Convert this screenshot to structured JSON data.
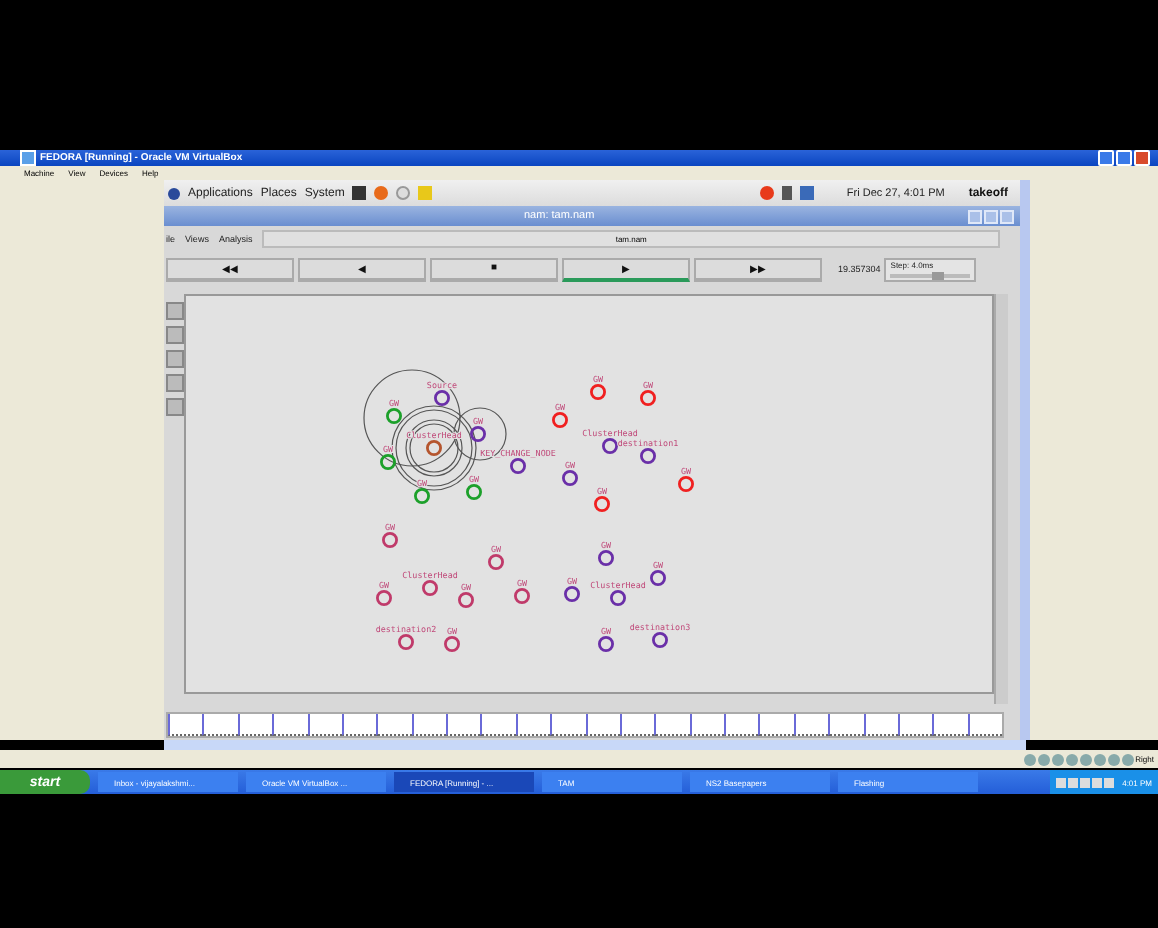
{
  "vbox": {
    "title": "FEDORA [Running] - Oracle VM VirtualBox",
    "menu": [
      "Machine",
      "View",
      "Devices",
      "Help"
    ],
    "host_key": "Right"
  },
  "panel": {
    "menus": [
      "Applications",
      "Places",
      "System"
    ],
    "clock": "Fri Dec 27,  4:01 PM",
    "user": "takeoff"
  },
  "nam": {
    "title": "nam: tam.nam",
    "menu": [
      "ile",
      "Views",
      "Analysis"
    ],
    "file": "tam.nam",
    "controls": [
      {
        "label": "◀◀",
        "selected": false
      },
      {
        "label": "◀",
        "selected": false
      },
      {
        "label": "■",
        "selected": false
      },
      {
        "label": "▶",
        "selected": true
      },
      {
        "label": "▶▶",
        "selected": false
      }
    ],
    "time": "19.357304",
    "step": {
      "label": "Step: 4.0ms",
      "level": 0.6
    },
    "nodes": [
      {
        "label": "Source",
        "color": "#6a2fa8"
      },
      {
        "label": "GW",
        "color": "#1ca02a"
      },
      {
        "label": "ClusterHead",
        "color": "#b5552e"
      },
      {
        "label": "GW",
        "color": "#6a2fa8"
      },
      {
        "label": "GW",
        "color": "#1ca02a"
      },
      {
        "label": "GW",
        "color": "#1ca02a"
      },
      {
        "label": "GW",
        "color": "#1ca02a"
      },
      {
        "label": "KEY_CHANGE_NODE",
        "color": "#6a2fa8"
      },
      {
        "label": "GW",
        "color": "#f02020"
      },
      {
        "label": "GW",
        "color": "#f02020"
      },
      {
        "label": "GW",
        "color": "#f02020"
      },
      {
        "label": "ClusterHead",
        "color": "#6a2fa8"
      },
      {
        "label": "destination1",
        "color": "#6a2fa8"
      },
      {
        "label": "GW",
        "color": "#6a2fa8"
      },
      {
        "label": "GW",
        "color": "#f02020"
      },
      {
        "label": "GW",
        "color": "#f02020"
      },
      {
        "label": "GW",
        "color": "#c03a6a"
      },
      {
        "label": "GW",
        "color": "#c03a6a"
      },
      {
        "label": "ClusterHead",
        "color": "#c03a6a"
      },
      {
        "label": "GW",
        "color": "#c03a6a"
      },
      {
        "label": "GW",
        "color": "#c03a6a"
      },
      {
        "label": "GW",
        "color": "#c03a6a"
      },
      {
        "label": "destination2",
        "color": "#c03a6a"
      },
      {
        "label": "GW",
        "color": "#c03a6a"
      },
      {
        "label": "GW",
        "color": "#6a2fa8"
      },
      {
        "label": "GW",
        "color": "#6a2fa8"
      },
      {
        "label": "GW",
        "color": "#6a2fa8"
      },
      {
        "label": "ClusterHead",
        "color": "#6a2fa8"
      },
      {
        "label": "GW",
        "color": "#6a2fa8"
      },
      {
        "label": "destination3",
        "color": "#6a2fa8"
      }
    ]
  },
  "taskbar": {
    "start": "start",
    "items": [
      {
        "label": "Inbox - vijayalakshmi...",
        "selected": false
      },
      {
        "label": "Oracle VM VirtualBox ...",
        "selected": false
      },
      {
        "label": "FEDORA [Running] - ...",
        "selected": true
      },
      {
        "label": "TAM",
        "selected": false
      },
      {
        "label": "NS2 Basepapers",
        "selected": false
      },
      {
        "label": "Flashing",
        "selected": false
      }
    ],
    "clock": "4:01 PM"
  }
}
